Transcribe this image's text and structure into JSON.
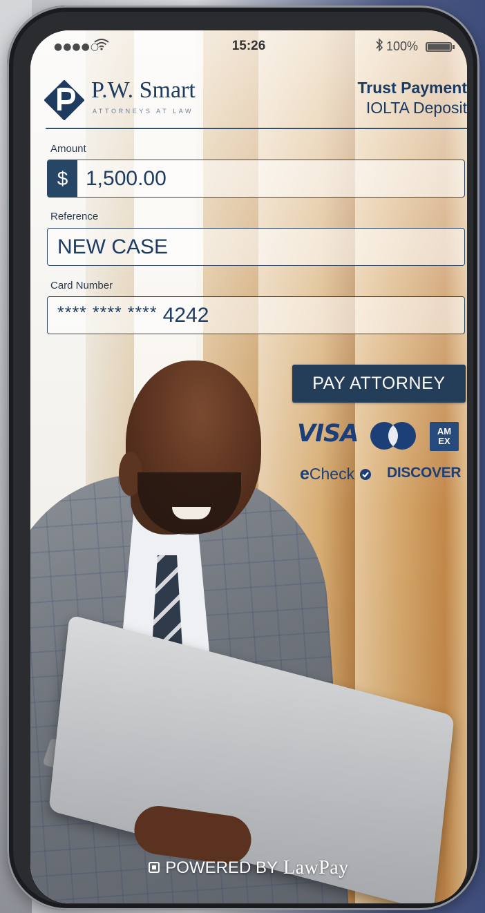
{
  "status_bar": {
    "signal": "●●●●○",
    "time": "15:26",
    "battery": "100%"
  },
  "brand": {
    "name": "P.W. Smart",
    "tagline": "ATTORNEYS AT LAW"
  },
  "header": {
    "title": "Trust Payment",
    "subtitle": "IOLTA Deposit"
  },
  "form": {
    "amount": {
      "label": "Amount",
      "prefix": "$",
      "value": "1,500.00"
    },
    "reference": {
      "label": "Reference",
      "value": "NEW CASE"
    },
    "card": {
      "label": "Card Number",
      "mask": "**** **** ****",
      "last4": "4242"
    }
  },
  "pay_button_label": "PAY ATTORNEY",
  "payment_methods": {
    "visa": "VISA",
    "amex_line1": "AM",
    "amex_line2": "EX",
    "echeck_e": "e",
    "echeck_rest": "Check",
    "discover": "DISCOVER"
  },
  "footer": {
    "powered": "POWERED BY",
    "lawpay": "LawPay"
  },
  "colors": {
    "brand_navy": "#1e3a5f",
    "button": "#243d58",
    "accent_blue": "#1c3f78"
  }
}
